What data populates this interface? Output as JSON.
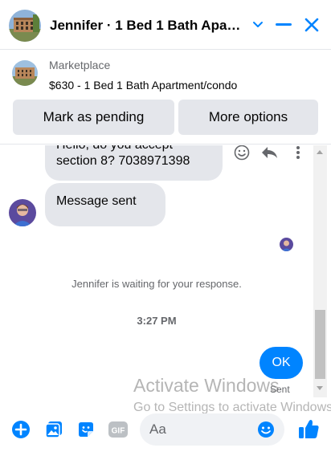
{
  "header": {
    "title": "Jennifer · 1 Bed 1 Bath Apartment/condo",
    "avatar_icon": "apartment-photo",
    "chevron_icon": "chevron-down-icon",
    "minimize_icon": "minimize-icon",
    "close_icon": "close-icon"
  },
  "marketplace": {
    "label": "Marketplace",
    "item": "$630 - 1 Bed 1 Bath Apartment/condo",
    "mark_pending_label": "Mark as pending",
    "more_options_label": "More options"
  },
  "chat": {
    "messages_in": [
      {
        "text": "Hello, do you accept section 8? 7038971398"
      },
      {
        "text": "Message sent"
      }
    ],
    "waiting_text": "Jennifer is waiting for your response.",
    "timestamp": "3:27 PM",
    "outgoing": {
      "text": "OK",
      "status": "Sent"
    }
  },
  "watermark": {
    "line1": "Activate Windows",
    "line2": "Go to Settings to activate Windows."
  },
  "composer": {
    "placeholder": "Aa",
    "icons": [
      "plus-icon",
      "photo-icon",
      "sticker-icon",
      "gif-icon",
      "emoji-icon",
      "thumbs-up-icon"
    ]
  },
  "colors": {
    "accent": "#0084ff",
    "bubble_in": "#e4e6eb",
    "button_bg": "#e4e6eb",
    "muted_text": "#65676b"
  }
}
